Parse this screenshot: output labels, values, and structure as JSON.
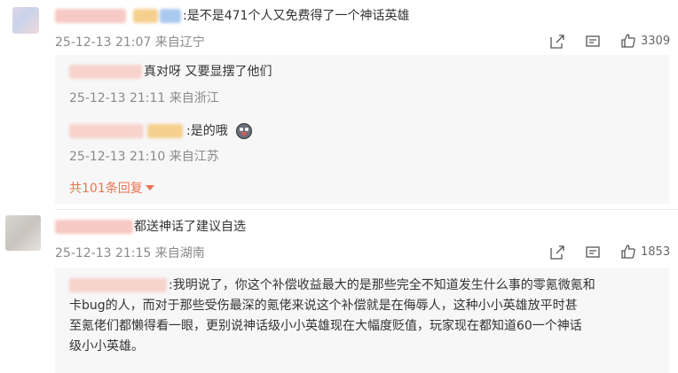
{
  "comments": [
    {
      "text": ":是不是471个人又免费得了一个神话英雄",
      "time": "25-12-13 21:07",
      "location": "来自辽宁",
      "like_count": "3309",
      "replies": [
        {
          "text": "真对呀 又要显摆了他们",
          "time": "25-12-13 21:11",
          "location": "来自浙江"
        },
        {
          "text": ":是的哦",
          "time": "25-12-13 21:10",
          "location": "来自江苏"
        }
      ],
      "more_replies": "共101条回复"
    },
    {
      "text": "都送神话了建议自选",
      "time": "25-12-13 21:15",
      "location": "来自湖南",
      "like_count": "1853",
      "replies": [
        {
          "lines": [
            ":我明说了，你这个补偿收益最大的是那些完全不知道发生什么事的零氪微氪和",
            "卡bug的人，而对于那些受伤最深的氪佬来说这个补偿就是在侮辱人，这种小小英雄放平时甚",
            "至氪佬们都懒得看一眼，更别说神话级小小英雄现在大幅度贬值，玩家现在都知道60一个神话",
            "级小小英雄。"
          ]
        }
      ]
    }
  ],
  "icons": {
    "share": "share-icon",
    "comment": "comment-icon",
    "like": "thumbs-up-icon",
    "emoji": "laughing-face-emoji"
  },
  "colors": {
    "accent": "#eb7350",
    "meta": "#8a8a8a",
    "reply_bg": "#f7f7f7"
  }
}
